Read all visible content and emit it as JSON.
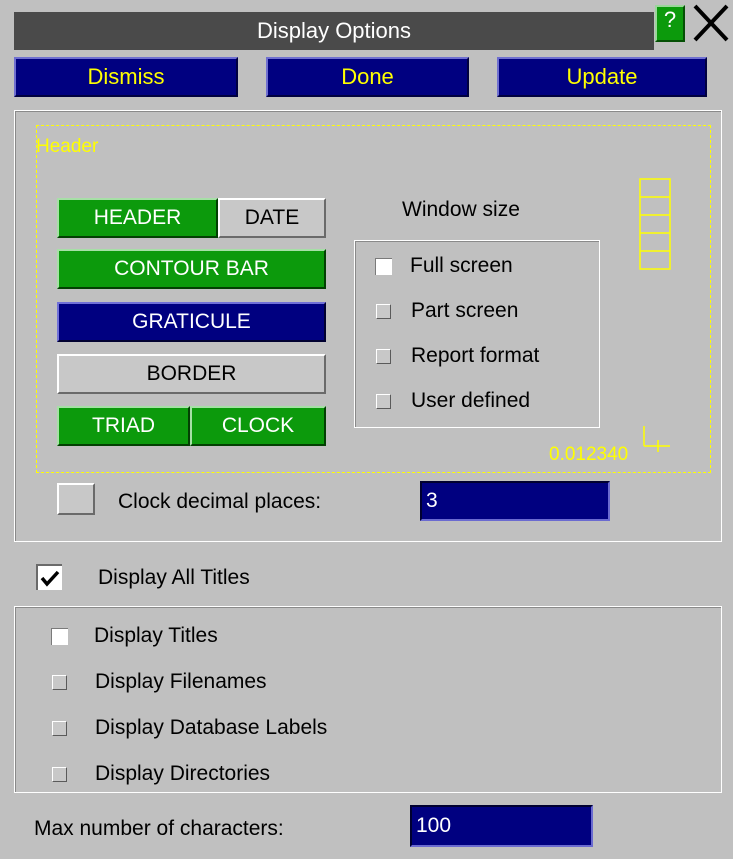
{
  "window": {
    "title": "Display Options",
    "help_label": "?",
    "close_icon": "close-icon"
  },
  "toolbar": {
    "dismiss_label": "Dismiss",
    "done_label": "Done",
    "update_label": "Update"
  },
  "header_panel": {
    "section_label": "Header",
    "buttons": {
      "header": "HEADER",
      "date": "DATE",
      "contour_bar": "CONTOUR BAR",
      "graticule": "GRATICULE",
      "border": "BORDER",
      "triad": "TRIAD",
      "clock": "CLOCK"
    },
    "window_size": {
      "title": "Window size",
      "options": [
        "Full screen",
        "Part screen",
        "Report format",
        "User defined"
      ],
      "selected": "Full screen"
    },
    "sample_number": "0.012340",
    "clock_decimal": {
      "label": "Clock decimal places:",
      "value": "3"
    }
  },
  "titles": {
    "display_all_label": "Display All Titles",
    "display_all_checked": true,
    "options": [
      "Display Titles",
      "Display Filenames",
      "Display Database Labels",
      "Display Directories"
    ],
    "selected": "Display Titles"
  },
  "max_chars": {
    "label": "Max number of characters:",
    "value": "100"
  },
  "colors": {
    "background": "#c0c0c0",
    "green": "#0c9a0c",
    "navy": "#000080",
    "yellow": "#ffff00"
  }
}
